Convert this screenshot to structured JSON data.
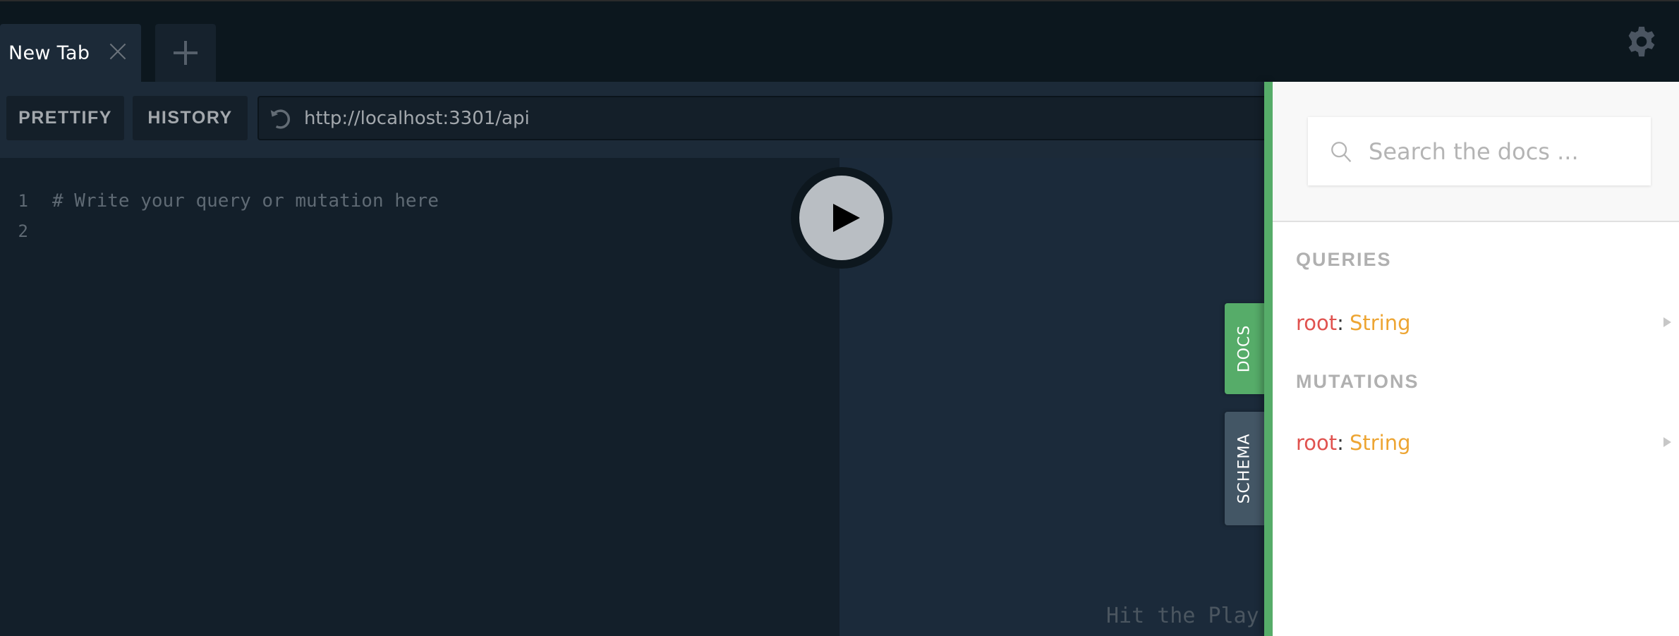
{
  "tabs": [
    {
      "title": "New Tab",
      "active": true
    }
  ],
  "add_tab_icon": "plus-icon",
  "settings_icon": "gear-icon",
  "toolbar": {
    "prettify_label": "PRETTIFY",
    "history_label": "HISTORY",
    "reload_icon": "reload-icon",
    "endpoint_url": "http://localhost:3301/api"
  },
  "editor": {
    "lines": [
      {
        "number": "1",
        "text": "# Write your query or mutation here"
      },
      {
        "number": "2",
        "text": ""
      }
    ]
  },
  "run_button_icon": "play-icon",
  "results": {
    "placeholder": "Hit the Play Button to get a response here"
  },
  "side_tabs": {
    "docs_label": "DOCS",
    "schema_label": "SCHEMA"
  },
  "docs": {
    "search_placeholder": "Search the docs ...",
    "sections": [
      {
        "title": "QUERIES",
        "fields": [
          {
            "name": "root",
            "colon": ":",
            "type": "String"
          }
        ]
      },
      {
        "title": "MUTATIONS",
        "fields": [
          {
            "name": "root",
            "colon": ":",
            "type": "String"
          }
        ]
      }
    ]
  },
  "colors": {
    "accent_green": "#56ac69",
    "field_name": "#e0524f",
    "field_type": "#eda533"
  }
}
